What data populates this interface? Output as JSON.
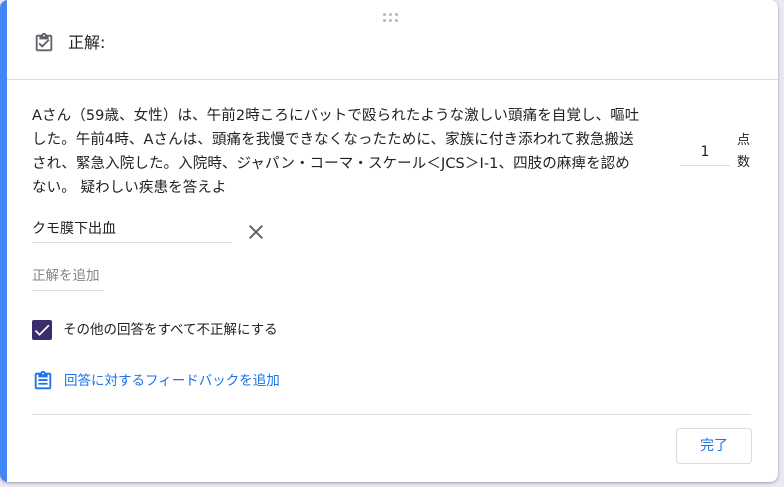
{
  "header": {
    "title": "正解:",
    "icon": "assignment-turned-in-icon"
  },
  "question": {
    "text": "Aさん（59歳、女性）は、午前2時ころにバットで殴られたような激しい頭痛を自覚し、嘔吐した。午前4時、Aさんは、頭痛を我慢できなくなったために、家族に付き添われて救急搬送され、緊急入院した。入院時、ジャパン・コーマ・スケール＜JCS＞Ⅰ-1、四肢の麻痺を認めない。 疑わしい疾患を答えよ"
  },
  "points": {
    "value": "1",
    "label": "点数"
  },
  "answers": [
    {
      "text": "クモ膜下出血"
    }
  ],
  "add_answer": {
    "placeholder": "正解を追加"
  },
  "mark_others_incorrect": {
    "label": "その他の回答をすべて不正解にする",
    "checked": true
  },
  "feedback": {
    "label": "回答に対するフィードバックを追加"
  },
  "done_button": {
    "label": "完了"
  },
  "colors": {
    "accent": "#4285f4",
    "link": "#1a73e8",
    "checkbox": "#3b2c6e"
  }
}
